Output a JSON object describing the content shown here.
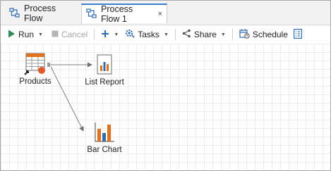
{
  "tabs": [
    {
      "label": "Process Flow",
      "active": false
    },
    {
      "label": "Process Flow 1",
      "active": true,
      "close": "×"
    }
  ],
  "toolbar": {
    "run": "Run",
    "cancel": "Cancel",
    "tasks": "Tasks",
    "share": "Share",
    "schedule": "Schedule"
  },
  "nodes": {
    "products": "Products",
    "list_report": "List Report",
    "bar_chart": "Bar Chart"
  },
  "colors": {
    "accent": "#3d7dca",
    "run_green": "#2e8b57",
    "bar_orange": "#e0711d",
    "bar_blue": "#2f6db5",
    "status_dot": "#e05a28"
  },
  "icons": [
    "process-flow-icon",
    "close-icon",
    "run-icon",
    "stop-icon",
    "plus-icon",
    "tasks-icon",
    "share-icon",
    "schedule-icon",
    "properties-icon",
    "table-icon",
    "report-icon",
    "bar-chart-icon"
  ]
}
